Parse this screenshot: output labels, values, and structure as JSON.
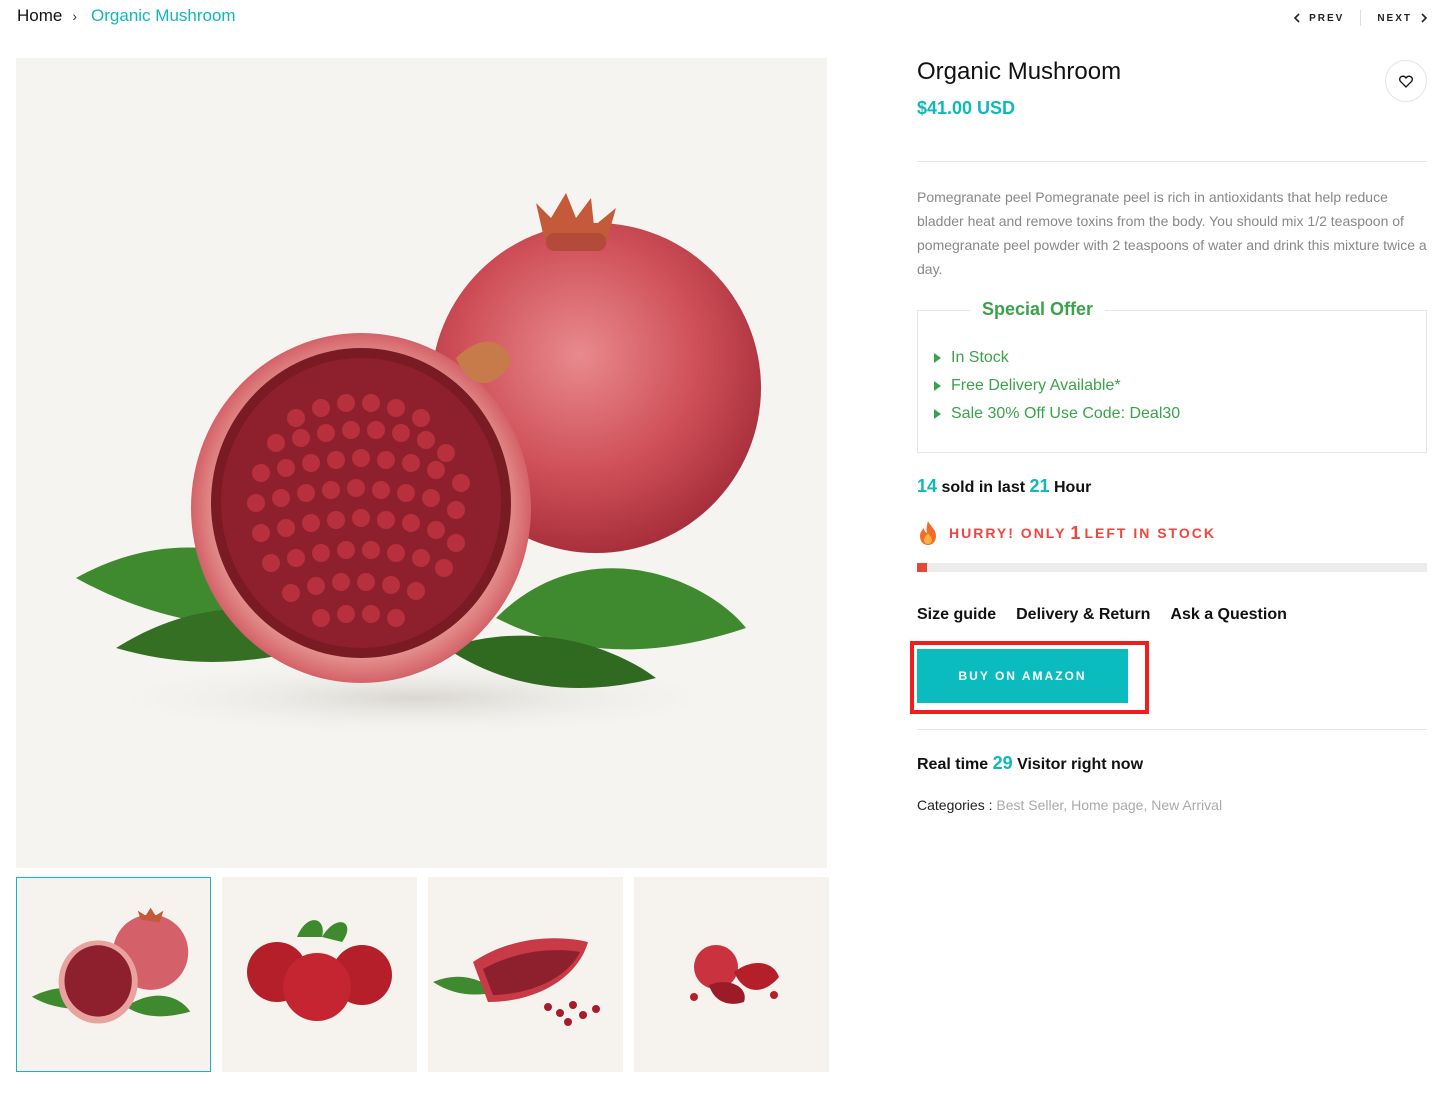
{
  "breadcrumb": {
    "home": "Home",
    "current": "Organic Mushroom"
  },
  "pager": {
    "prev": "PREV",
    "next": "NEXT"
  },
  "product": {
    "title": "Organic Mushroom",
    "price": "$41.00 USD",
    "description": "Pomegranate peel Pomegranate peel is rich in antioxidants that help reduce bladder heat and remove toxins from the body. You should mix 1/2 teaspoon of pomegranate peel powder with 2 teaspoons of water and drink this mixture twice a day."
  },
  "offer": {
    "title": "Special Offer",
    "items": [
      "In Stock",
      "Free Delivery Available*",
      "Sale 30% Off Use Code: Deal30"
    ]
  },
  "sold": {
    "count": "14",
    "text1": "sold in last",
    "hours": "21",
    "text2": "Hour"
  },
  "stock": {
    "prefix": "HURRY! ONLY",
    "count": "1",
    "suffix": "LEFT IN STOCK",
    "level": 0.02
  },
  "links": {
    "size_guide": "Size guide",
    "delivery": "Delivery & Return",
    "ask": "Ask a Question"
  },
  "buy_button": "BUY ON AMAZON",
  "visitors": {
    "prefix": "Real time",
    "count": "29",
    "suffix": "Visitor right now"
  },
  "categories": {
    "label": "Categories :",
    "items": [
      "Best Seller,",
      "Home page,",
      "New Arrival"
    ]
  },
  "colors": {
    "accent": "#0fb8bb",
    "offer_green": "#3aa34a",
    "alert_red": "#f0453f",
    "highlight": "#f21d1d"
  }
}
